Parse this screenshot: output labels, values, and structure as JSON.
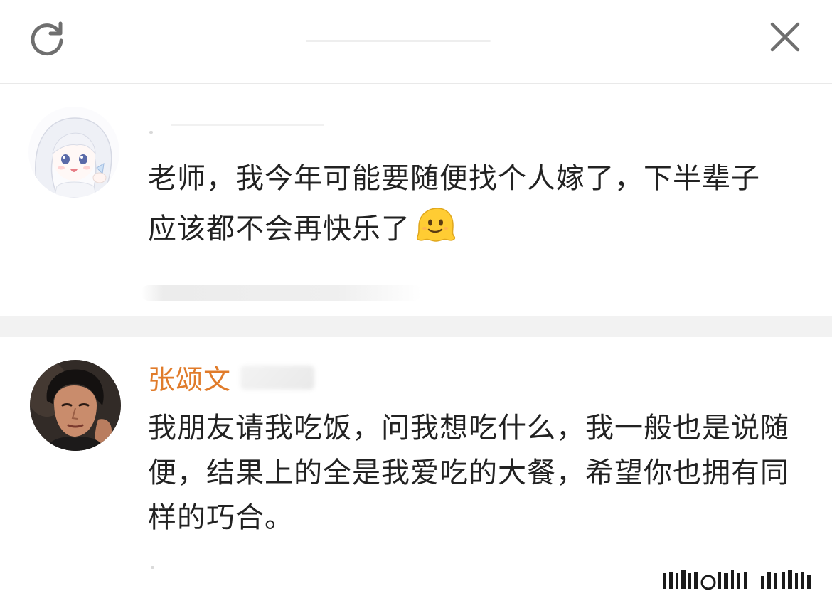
{
  "header": {
    "refresh_icon": "refresh-icon",
    "close_icon": "close-icon"
  },
  "comments": [
    {
      "text": "老师，我今年可能要随便找个人嫁了，下半辈子应该都不会再快乐了",
      "emoji": "melting-face-emoji"
    },
    {
      "name": "张颂文",
      "text": "我朋友请我吃饭，问我想吃什么，我一般也是说随便，结果上的全是我爱吃的大餐，希望你也拥有同样的巧合。",
      "name_color": "#e07b2a"
    }
  ],
  "colors": {
    "text": "#222222",
    "accent": "#e07b2a",
    "separator": "#f2f2f2"
  }
}
